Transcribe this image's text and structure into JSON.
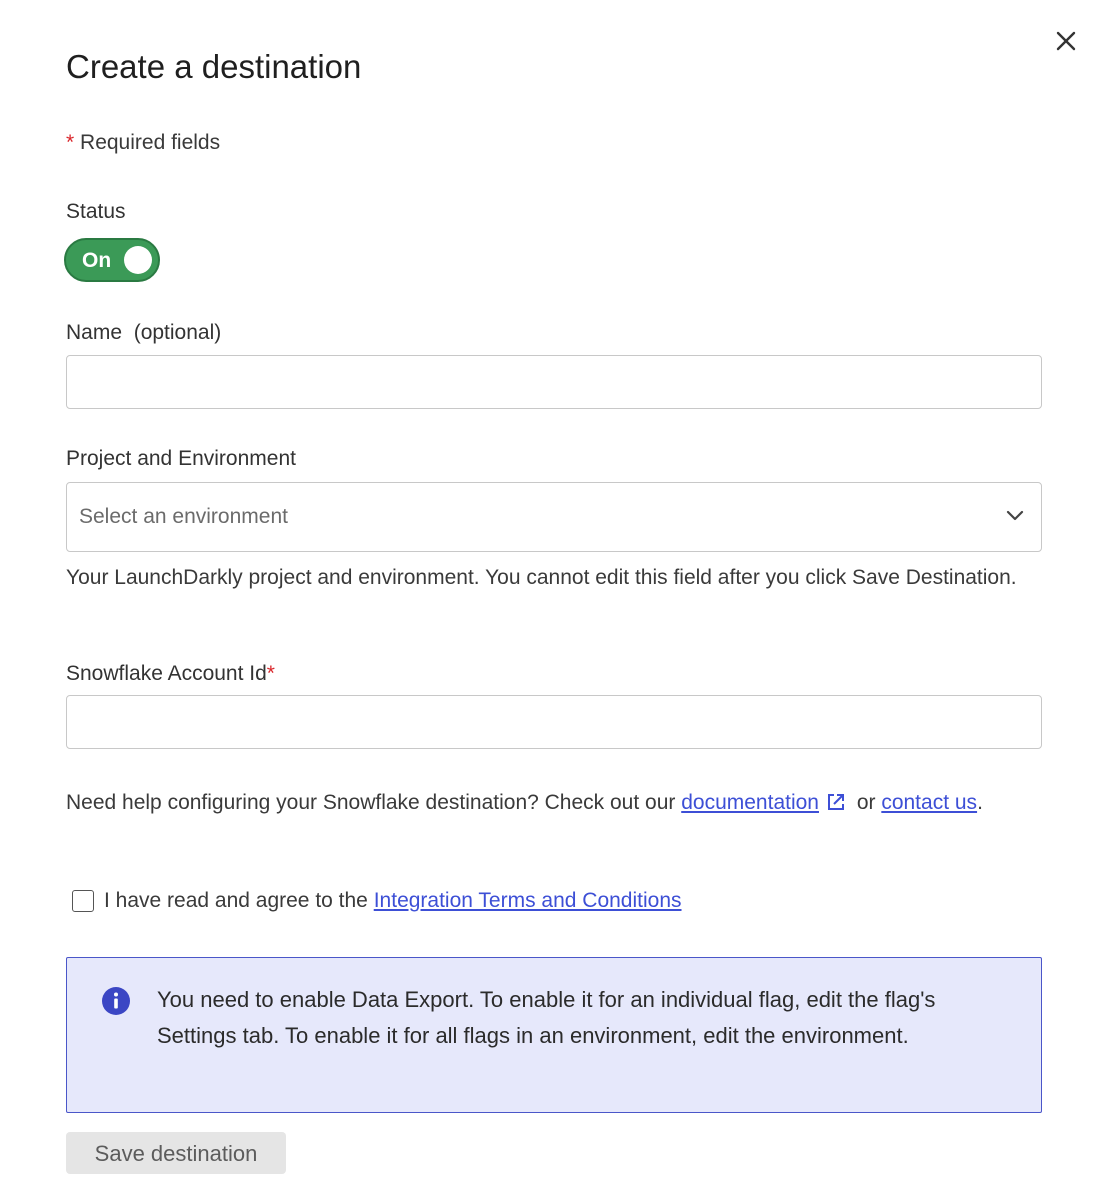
{
  "dialog": {
    "title": "Create a destination",
    "required_asterisk": "*",
    "required_note": " Required fields"
  },
  "status": {
    "label": "Status",
    "toggle_text": "On",
    "toggle_on": true,
    "toggle_color": "#3b9a57"
  },
  "name_field": {
    "label": "Name",
    "optional": "(optional)",
    "value": ""
  },
  "project_env": {
    "label": "Project and Environment",
    "placeholder": "Select an environment",
    "hint": "Your LaunchDarkly project and environment. You cannot edit this field after you click Save Destination."
  },
  "account_id": {
    "label": "Snowflake Account Id",
    "required_asterisk": "*",
    "value": ""
  },
  "help": {
    "prefix": "Need help configuring your Snowflake destination? Check out our ",
    "doc_link": "documentation",
    "middle": " or ",
    "contact_link": "contact us",
    "suffix": "."
  },
  "terms": {
    "prefix": "I have read and agree to the ",
    "link": "Integration Terms and Conditions",
    "checked": false
  },
  "info": {
    "text": "You need to enable Data Export. To enable it for an individual flag, edit the flag's Settings tab. To enable it for all flags in an environment, edit the environment.",
    "accent_color": "#4a56c9",
    "icon": "info-icon"
  },
  "footer": {
    "save_label": "Save destination"
  }
}
